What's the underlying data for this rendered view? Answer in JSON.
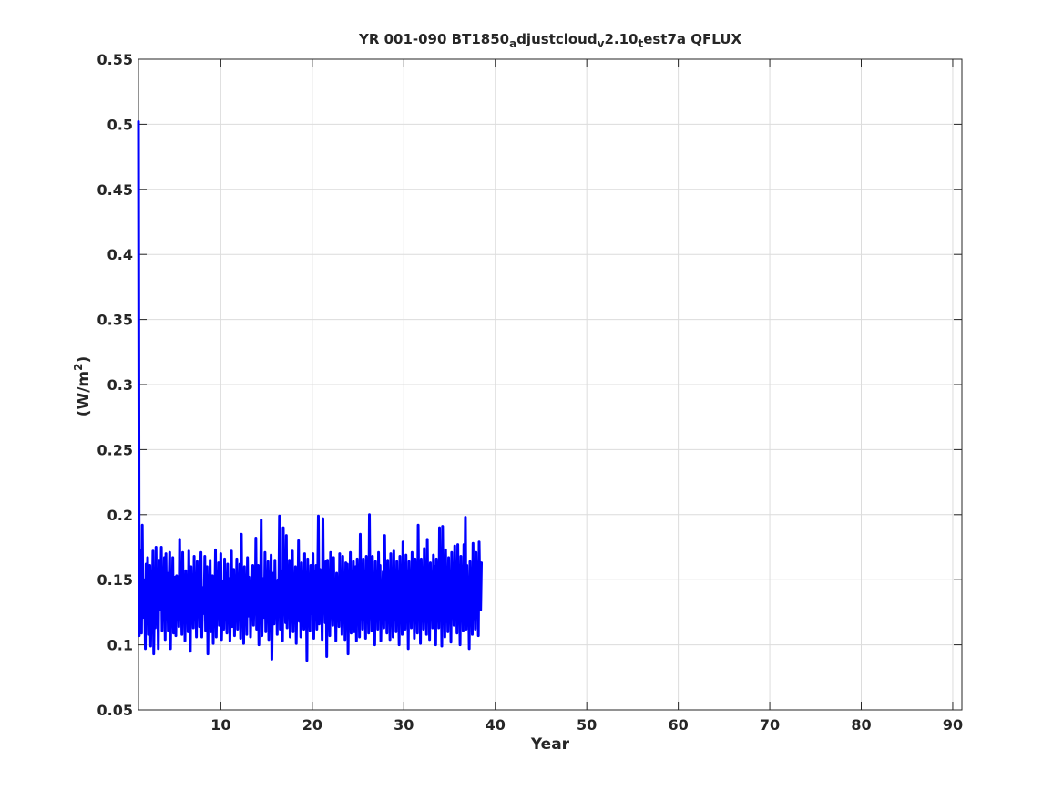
{
  "chart_data": {
    "type": "line",
    "title_parts": [
      {
        "text": "YR 001-090 BT1850",
        "sub": false
      },
      {
        "text": "a",
        "sub": true
      },
      {
        "text": "djustcloud",
        "sub": false
      },
      {
        "text": "v",
        "sub": true
      },
      {
        "text": "2.10",
        "sub": false
      },
      {
        "text": "t",
        "sub": true
      },
      {
        "text": "est7a QFLUX",
        "sub": false
      }
    ],
    "xlabel": "Year",
    "ylabel": {
      "main": "(W/m",
      "sup": "2",
      "close": ")"
    },
    "xlim": [
      1,
      91
    ],
    "ylim": [
      0.05,
      0.55
    ],
    "xticks": [
      "10",
      "20",
      "30",
      "40",
      "50",
      "60",
      "70",
      "80",
      "90"
    ],
    "yticks": [
      "0.05",
      "0.1",
      "0.15",
      "0.2",
      "0.25",
      "0.3",
      "0.35",
      "0.4",
      "0.45",
      "0.5",
      "0.55"
    ],
    "grid": true,
    "series_color": "#0000ff",
    "series": [
      {
        "x_start": 1.0,
        "x_step": 0.0833,
        "values": [
          0.502,
          0.107,
          0.173,
          0.128,
          0.109,
          0.192,
          0.121,
          0.135,
          0.15,
          0.097,
          0.162,
          0.127,
          0.167,
          0.108,
          0.145,
          0.161,
          0.099,
          0.146,
          0.128,
          0.172,
          0.093,
          0.138,
          0.113,
          0.175,
          0.122,
          0.147,
          0.097,
          0.165,
          0.127,
          0.142,
          0.175,
          0.111,
          0.15,
          0.127,
          0.167,
          0.104,
          0.17,
          0.129,
          0.155,
          0.111,
          0.146,
          0.171,
          0.097,
          0.147,
          0.128,
          0.167,
          0.109,
          0.135,
          0.152,
          0.107,
          0.153,
          0.13,
          0.145,
          0.114,
          0.181,
          0.122,
          0.142,
          0.108,
          0.171,
          0.126,
          0.149,
          0.103,
          0.157,
          0.134,
          0.147,
          0.11,
          0.172,
          0.121,
          0.095,
          0.16,
          0.128,
          0.145,
          0.113,
          0.168,
          0.121,
          0.147,
          0.106,
          0.164,
          0.127,
          0.158,
          0.114,
          0.145,
          0.171,
          0.106,
          0.131,
          0.144,
          0.124,
          0.168,
          0.111,
          0.139,
          0.16,
          0.093,
          0.147,
          0.13,
          0.165,
          0.11,
          0.141,
          0.153,
          0.101,
          0.142,
          0.13,
          0.173,
          0.106,
          0.15,
          0.125,
          0.163,
          0.115,
          0.138,
          0.17,
          0.104,
          0.132,
          0.149,
          0.112,
          0.166,
          0.129,
          0.142,
          0.109,
          0.162,
          0.128,
          0.151,
          0.103,
          0.144,
          0.172,
          0.114,
          0.136,
          0.158,
          0.107,
          0.14,
          0.127,
          0.166,
          0.112,
          0.148,
          0.13,
          0.162,
          0.105,
          0.185,
          0.117,
          0.143,
          0.101,
          0.16,
          0.13,
          0.146,
          0.108,
          0.167,
          0.122,
          0.135,
          0.152,
          0.106,
          0.142,
          0.129,
          0.161,
          0.115,
          0.146,
          0.125,
          0.182,
          0.112,
          0.141,
          0.161,
          0.1,
          0.152,
          0.129,
          0.196,
          0.107,
          0.138,
          0.151,
          0.121,
          0.171,
          0.11,
          0.146,
          0.13,
          0.164,
          0.104,
          0.147,
          0.126,
          0.169,
          0.089,
          0.139,
          0.155,
          0.116,
          0.165,
          0.124,
          0.146,
          0.108,
          0.15,
          0.131,
          0.199,
          0.112,
          0.141,
          0.157,
          0.103,
          0.19,
          0.127,
          0.148,
          0.117,
          0.184,
          0.113,
          0.155,
          0.13,
          0.165,
          0.106,
          0.142,
          0.124,
          0.172,
          0.11,
          0.151,
          0.128,
          0.16,
          0.101,
          0.143,
          0.126,
          0.18,
          0.118,
          0.152,
          0.106,
          0.163,
          0.129,
          0.147,
          0.112,
          0.17,
          0.123,
          0.153,
          0.088,
          0.166,
          0.128,
          0.147,
          0.111,
          0.161,
          0.124,
          0.14,
          0.17,
          0.105,
          0.156,
          0.128,
          0.161,
          0.112,
          0.143,
          0.199,
          0.116,
          0.158,
          0.127,
          0.142,
          0.104,
          0.197,
          0.13,
          0.15,
          0.117,
          0.164,
          0.091,
          0.165,
          0.134,
          0.145,
          0.107,
          0.171,
          0.124,
          0.14,
          0.115,
          0.167,
          0.121,
          0.147,
          0.103,
          0.155,
          0.131,
          0.143,
          0.114,
          0.17,
          0.119,
          0.142,
          0.108,
          0.168,
          0.126,
          0.147,
          0.104,
          0.163,
          0.129,
          0.162,
          0.093,
          0.145,
          0.131,
          0.171,
          0.109,
          0.15,
          0.126,
          0.164,
          0.11,
          0.145,
          0.16,
          0.103,
          0.166,
          0.132,
          0.147,
          0.106,
          0.185,
          0.121,
          0.143,
          0.112,
          0.166,
          0.126,
          0.152,
          0.105,
          0.168,
          0.129,
          0.144,
          0.109,
          0.2,
          0.131,
          0.142,
          0.111,
          0.168,
          0.123,
          0.149,
          0.1,
          0.164,
          0.127,
          0.152,
          0.112,
          0.171,
          0.129,
          0.161,
          0.103,
          0.14,
          0.131,
          0.156,
          0.113,
          0.184,
          0.125,
          0.143,
          0.109,
          0.165,
          0.132,
          0.147,
          0.104,
          0.17,
          0.122,
          0.138,
          0.106,
          0.172,
          0.126,
          0.152,
          0.11,
          0.164,
          0.134,
          0.145,
          0.1,
          0.168,
          0.132,
          0.153,
          0.108,
          0.179,
          0.126,
          0.142,
          0.112,
          0.169,
          0.129,
          0.157,
          0.097,
          0.164,
          0.132,
          0.151,
          0.113,
          0.171,
          0.123,
          0.145,
          0.105,
          0.166,
          0.131,
          0.141,
          0.109,
          0.192,
          0.123,
          0.157,
          0.101,
          0.166,
          0.133,
          0.147,
          0.112,
          0.174,
          0.125,
          0.139,
          0.108,
          0.181,
          0.13,
          0.15,
          0.104,
          0.163,
          0.127,
          0.145,
          0.113,
          0.169,
          0.125,
          0.16,
          0.1,
          0.166,
          0.129,
          0.145,
          0.113,
          0.19,
          0.123,
          0.153,
          0.099,
          0.191,
          0.129,
          0.148,
          0.106,
          0.173,
          0.13,
          0.142,
          0.11,
          0.167,
          0.122,
          0.15,
          0.102,
          0.171,
          0.132,
          0.151,
          0.115,
          0.176,
          0.125,
          0.143,
          0.109,
          0.177,
          0.13,
          0.15,
          0.1,
          0.168,
          0.125,
          0.152,
          0.111,
          0.177,
          0.13,
          0.198,
          0.112,
          0.161,
          0.127,
          0.145,
          0.097,
          0.164,
          0.131,
          0.152,
          0.108,
          0.178,
          0.125,
          0.144,
          0.112,
          0.171,
          0.136,
          0.157,
          0.107,
          0.179,
          0.141,
          0.127,
          0.163
        ]
      }
    ]
  }
}
